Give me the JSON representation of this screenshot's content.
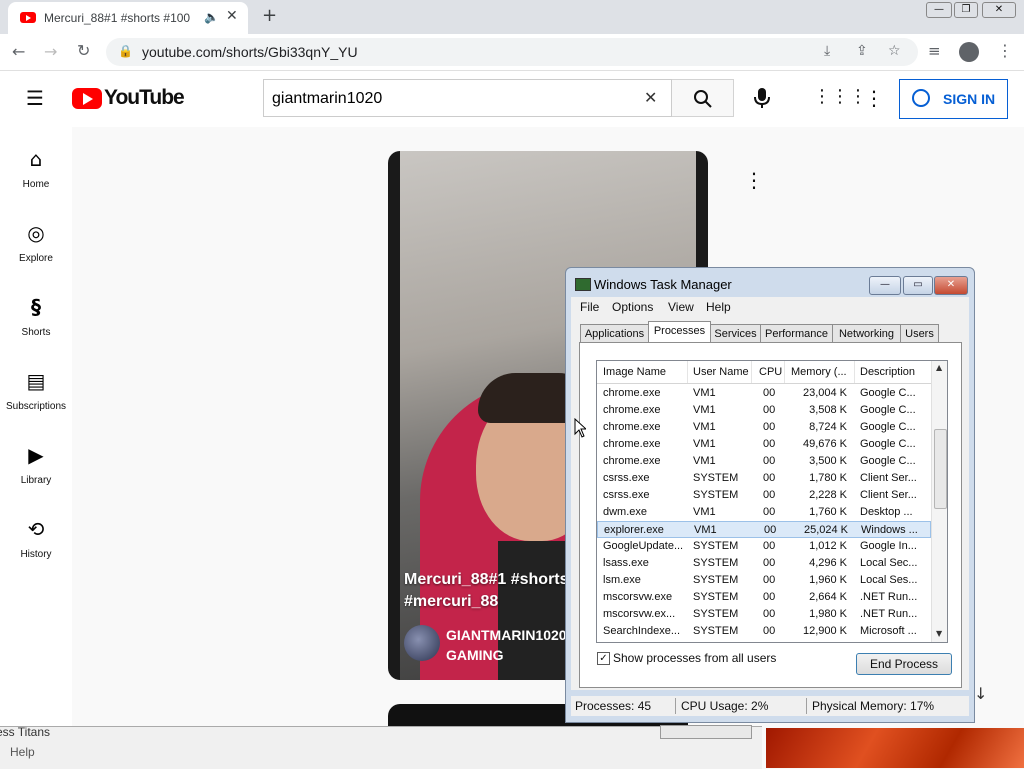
{
  "browser": {
    "tab_title": "Mercuri_88#1 #shorts #100",
    "url": "youtube.com/shorts/Gbi33qnY_YU"
  },
  "youtube": {
    "logo_text": "YouTube",
    "search_value": "giantmarin1020",
    "sign_in_label": "SIGN IN",
    "nav": [
      {
        "label": "Home",
        "icon": "home-icon"
      },
      {
        "label": "Explore",
        "icon": "compass-icon"
      },
      {
        "label": "Shorts",
        "icon": "shorts-icon"
      },
      {
        "label": "Subscriptions",
        "icon": "subscriptions-icon"
      },
      {
        "label": "Library",
        "icon": "library-icon"
      },
      {
        "label": "History",
        "icon": "history-icon"
      }
    ],
    "short": {
      "title": "Mercuri_88#1 #shorts #mercuri_88",
      "channel": "GIANTMARIN1020 GAMING"
    },
    "accent_color": "#ff0000",
    "link_color": "#065fd4"
  },
  "background_window": {
    "title_fragment": "ess Titans",
    "menu_fragment": "Help"
  },
  "task_manager": {
    "title": "Windows Task Manager",
    "menu": [
      "File",
      "Options",
      "View",
      "Help"
    ],
    "tabs": [
      "Applications",
      "Processes",
      "Services",
      "Performance",
      "Networking",
      "Users"
    ],
    "active_tab": "Processes",
    "columns": [
      "Image Name",
      "User Name",
      "CPU",
      "Memory (...",
      "Description"
    ],
    "rows": [
      {
        "name": "chrome.exe",
        "user": "VM1",
        "cpu": "00",
        "mem": "23,004 K",
        "desc": "Google C..."
      },
      {
        "name": "chrome.exe",
        "user": "VM1",
        "cpu": "00",
        "mem": "3,508 K",
        "desc": "Google C..."
      },
      {
        "name": "chrome.exe",
        "user": "VM1",
        "cpu": "00",
        "mem": "8,724 K",
        "desc": "Google C..."
      },
      {
        "name": "chrome.exe",
        "user": "VM1",
        "cpu": "00",
        "mem": "49,676 K",
        "desc": "Google C..."
      },
      {
        "name": "chrome.exe",
        "user": "VM1",
        "cpu": "00",
        "mem": "3,500 K",
        "desc": "Google C..."
      },
      {
        "name": "csrss.exe",
        "user": "SYSTEM",
        "cpu": "00",
        "mem": "1,780 K",
        "desc": "Client Ser..."
      },
      {
        "name": "csrss.exe",
        "user": "SYSTEM",
        "cpu": "00",
        "mem": "2,228 K",
        "desc": "Client Ser..."
      },
      {
        "name": "dwm.exe",
        "user": "VM1",
        "cpu": "00",
        "mem": "1,760 K",
        "desc": "Desktop ..."
      },
      {
        "name": "explorer.exe",
        "user": "VM1",
        "cpu": "00",
        "mem": "25,024 K",
        "desc": "Windows ..."
      },
      {
        "name": "GoogleUpdate...",
        "user": "SYSTEM",
        "cpu": "00",
        "mem": "1,012 K",
        "desc": "Google In..."
      },
      {
        "name": "lsass.exe",
        "user": "SYSTEM",
        "cpu": "00",
        "mem": "4,296 K",
        "desc": "Local Sec..."
      },
      {
        "name": "lsm.exe",
        "user": "SYSTEM",
        "cpu": "00",
        "mem": "1,960 K",
        "desc": "Local Ses..."
      },
      {
        "name": "mscorsvw.exe",
        "user": "SYSTEM",
        "cpu": "00",
        "mem": "2,664 K",
        "desc": ".NET Run..."
      },
      {
        "name": "mscorsvw.ex...",
        "user": "SYSTEM",
        "cpu": "00",
        "mem": "1,980 K",
        "desc": ".NET Run..."
      },
      {
        "name": "SearchIndexe...",
        "user": "SYSTEM",
        "cpu": "00",
        "mem": "12,900 K",
        "desc": "Microsoft ..."
      }
    ],
    "selected_row": "explorer.exe",
    "show_all_label": "Show processes from all users",
    "show_all_checked": true,
    "end_process_label": "End Process",
    "status": {
      "processes": "Processes: 45",
      "cpu": "CPU Usage: 2%",
      "memory": "Physical Memory: 17%"
    }
  }
}
